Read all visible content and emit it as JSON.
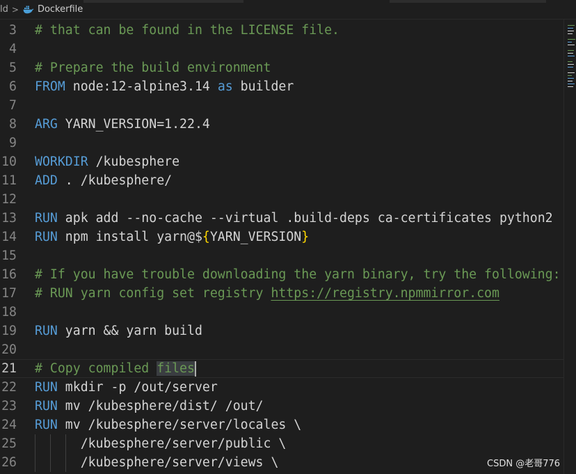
{
  "breadcrumb": {
    "parent": "ld",
    "separator": ">",
    "file": "Dockerfile"
  },
  "editor": {
    "active_line": 21,
    "lines": [
      {
        "num": "3",
        "text": "# that can be found in the LICENSE file."
      },
      {
        "num": "4",
        "text": ""
      },
      {
        "num": "5",
        "text": "# Prepare the build environment"
      },
      {
        "num": "6",
        "kw": "FROM",
        "text": " node:12-alpine3.14 ",
        "kw2": "as",
        "text2": " builder"
      },
      {
        "num": "7",
        "text": ""
      },
      {
        "num": "8",
        "kw": "ARG",
        "text": " YARN_VERSION=1.22.4"
      },
      {
        "num": "9",
        "text": ""
      },
      {
        "num": "10",
        "kw": "WORKDIR",
        "text": " /kubesphere"
      },
      {
        "num": "11",
        "kw": "ADD",
        "text": " . /kubesphere/"
      },
      {
        "num": "12",
        "text": ""
      },
      {
        "num": "13",
        "kw": "RUN",
        "text": " apk add --no-cache --virtual .build-deps ca-certificates python2"
      },
      {
        "num": "14",
        "kw": "RUN",
        "text": " npm install yarn@$",
        "brace_open": "{",
        "text2": "YARN_VERSION",
        "brace_close": "}"
      },
      {
        "num": "15",
        "text": ""
      },
      {
        "num": "16",
        "text": "# If you have trouble downloading the yarn binary, try the following:"
      },
      {
        "num": "17",
        "text": "# RUN yarn config set registry ",
        "link": "https://registry.npmmirror.com"
      },
      {
        "num": "18",
        "text": ""
      },
      {
        "num": "19",
        "kw": "RUN",
        "text": " yarn && yarn build"
      },
      {
        "num": "20",
        "text": ""
      },
      {
        "num": "21",
        "text": "# Copy compiled ",
        "selected": "files"
      },
      {
        "num": "22",
        "kw": "RUN",
        "text": " mkdir -p /out/server"
      },
      {
        "num": "23",
        "kw": "RUN",
        "text": " mv /kubesphere/dist/ /out/"
      },
      {
        "num": "24",
        "kw": "RUN",
        "text": " mv /kubesphere/server/locales \\"
      },
      {
        "num": "25",
        "text": "      /kubesphere/server/public \\"
      },
      {
        "num": "26",
        "text": "      /kubesphere/server/views \\"
      }
    ]
  },
  "watermark": "CSDN @老哥776",
  "colors": {
    "background": "#1e1e1e",
    "comment": "#6a9955",
    "keyword": "#569cd6",
    "text": "#d4d4d4",
    "bracket": "#ffd700",
    "line_number": "#858585"
  }
}
